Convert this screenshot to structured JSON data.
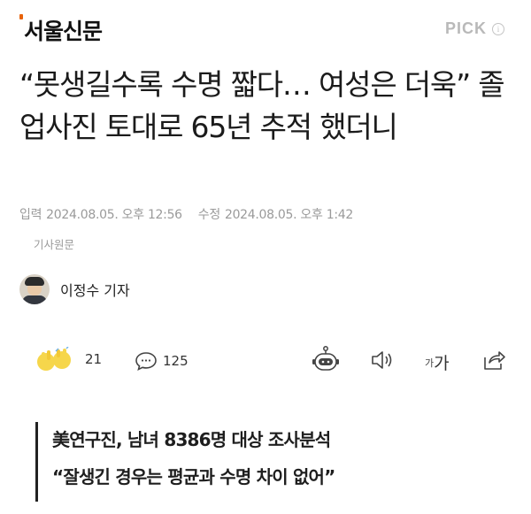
{
  "header": {
    "logo_text": "서울신문",
    "logo_accent_color": "#e8630a",
    "pick_label": "PICK",
    "pick_info_glyph": "i"
  },
  "article": {
    "headline": "“못생길수록 수명 짧다… 여성은 더욱” 졸업사진 토대로 65년 추적 했더니",
    "meta": {
      "input_label": "입력",
      "input_time": "2024.08.05. 오후 12:56",
      "modified_label": "수정",
      "modified_time": "2024.08.05. 오후 1:42"
    },
    "original_link": "기사원문",
    "reporter_name": "이정수 기자"
  },
  "actions": {
    "reactions_count": "21",
    "comments_count": "125",
    "font_size_label": "가",
    "tts_icon": "robot-speaker-icon",
    "sound_icon": "speaker-icon",
    "share_icon": "share-icon"
  },
  "summary": {
    "line1": "美연구진, 남녀 8386명 대상 조사분석",
    "line2": "“잘생긴 경우는 평균과 수명 차이 없어”"
  }
}
